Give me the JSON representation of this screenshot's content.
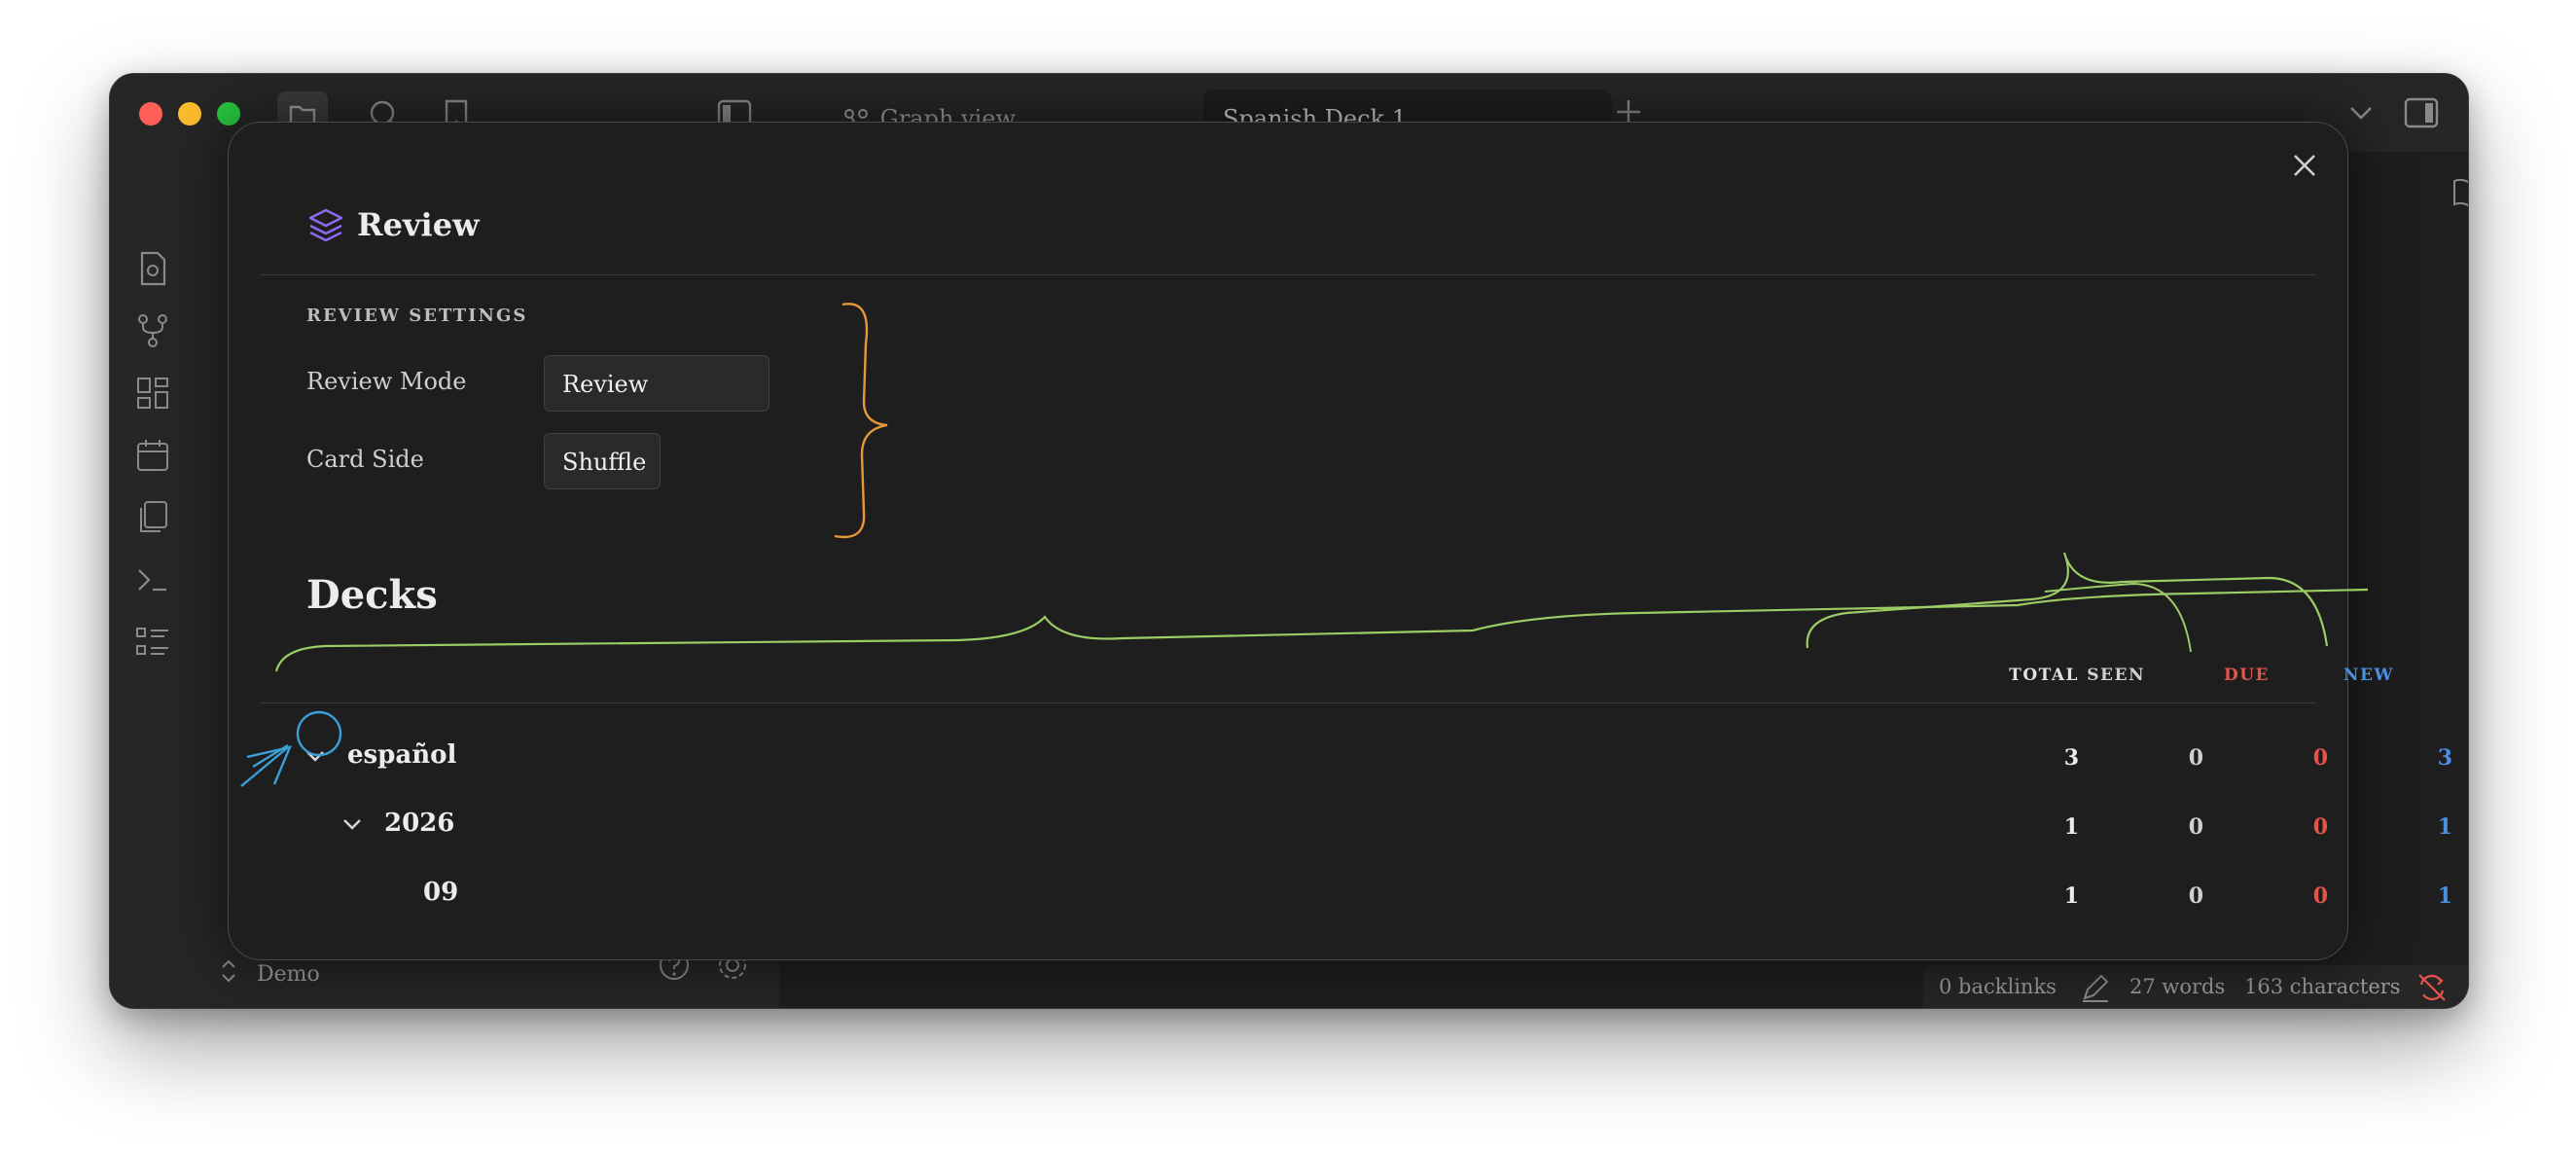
{
  "window": {
    "tabs": [
      {
        "label": "Graph view"
      },
      {
        "label": "Spanish Deck 1"
      }
    ],
    "vault_name": "Demo",
    "status": {
      "backlinks": "0 backlinks",
      "words": "27 words",
      "characters": "163 characters"
    }
  },
  "modal": {
    "title": "Review",
    "settings": {
      "heading": "REVIEW SETTINGS",
      "review_mode": {
        "label": "Review Mode",
        "value": "Review"
      },
      "card_side": {
        "label": "Card Side",
        "value": "Shuffle"
      }
    },
    "decks": {
      "heading": "Decks",
      "columns": {
        "total": "TOTAL",
        "seen": "SEEN",
        "due": "DUE",
        "new": "NEW"
      },
      "rows": [
        {
          "name": "español",
          "total": "3",
          "seen": "0",
          "due": "0",
          "new": "3"
        },
        {
          "name": "2026",
          "total": "1",
          "seen": "0",
          "due": "0",
          "new": "1"
        },
        {
          "name": "09",
          "total": "1",
          "seen": "0",
          "due": "0",
          "new": "1"
        }
      ]
    }
  },
  "colors": {
    "due": "#e5534b",
    "new": "#4a8fe0",
    "accent": "#8b6cf0",
    "annotation_orange": "#e7963a",
    "annotation_green": "#9ccc65",
    "annotation_blue": "#3a9fd6"
  },
  "icons": [
    "folder-icon",
    "search-icon",
    "bookmark-icon",
    "sidebar-toggle-icon",
    "graph-icon",
    "close-icon",
    "plus-icon",
    "chevron-down-icon",
    "layers-icon",
    "reading-icon",
    "more-icon",
    "pencil-icon",
    "sync-error-icon",
    "help-icon",
    "gear-icon"
  ]
}
